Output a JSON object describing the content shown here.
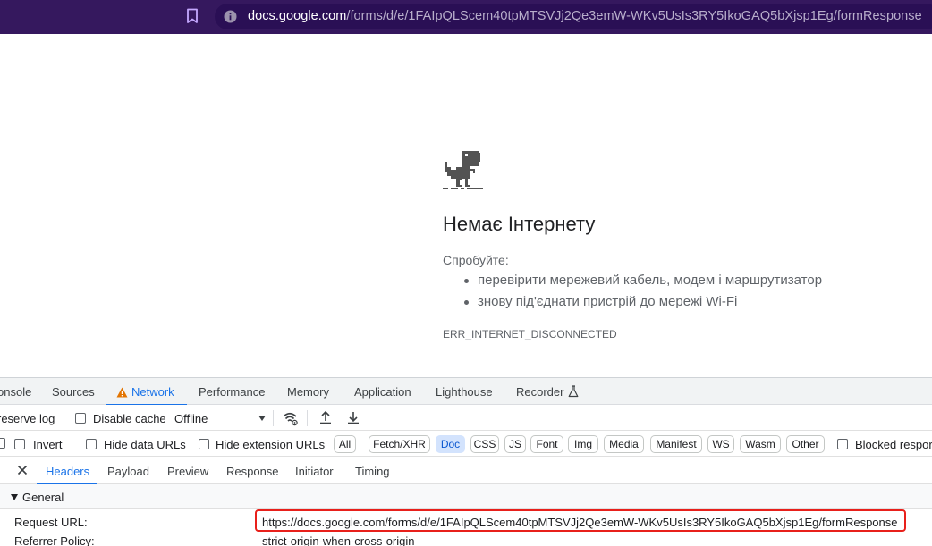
{
  "browser": {
    "url_host": "docs.google.com",
    "url_path": "/forms/d/e/1FAIpQLScem40tpMTSVJj2Qe3emW-WKv5UsIs3RY5IkoGAQ5bXjsp1Eg/formResponse"
  },
  "error_page": {
    "title": "Немає Інтернету",
    "try_label": "Спробуйте:",
    "suggestions": [
      "перевірити мережевий кабель, модем і маршрутизатор",
      "знову під'єднати пристрій до мережі Wi-Fi"
    ],
    "error_code": "ERR_INTERNET_DISCONNECTED"
  },
  "devtools": {
    "tabs": [
      "onsole",
      "Sources",
      "Network",
      "Performance",
      "Memory",
      "Application",
      "Lighthouse",
      "Recorder"
    ],
    "active_tab": "Network",
    "toolbar": {
      "preserve_log": "reserve log",
      "disable_cache": "Disable cache",
      "throttling": "Offline"
    },
    "filters": {
      "invert": "Invert",
      "hide_data_urls": "Hide data URLs",
      "hide_extension_urls": "Hide extension URLs",
      "types": [
        "All",
        "Fetch/XHR",
        "Doc",
        "CSS",
        "JS",
        "Font",
        "Img",
        "Media",
        "Manifest",
        "WS",
        "Wasm",
        "Other"
      ],
      "active_type": "Doc",
      "blocked": "Blocked respor"
    },
    "details_tabs": [
      "Headers",
      "Payload",
      "Preview",
      "Response",
      "Initiator",
      "Timing"
    ],
    "active_details_tab": "Headers",
    "general": {
      "label": "General",
      "rows": [
        {
          "label": "Request URL:",
          "value": "https://docs.google.com/forms/d/e/1FAIpQLScem40tpMTSVJj2Qe3emW-WKv5UsIs3RY5IkoGAQ5bXjsp1Eg/formResponse"
        },
        {
          "label": "Referrer Policy:",
          "value": "strict-origin-when-cross-origin"
        }
      ]
    },
    "accent_color": "#1a73e8",
    "highlight_color": "#e8201b"
  }
}
